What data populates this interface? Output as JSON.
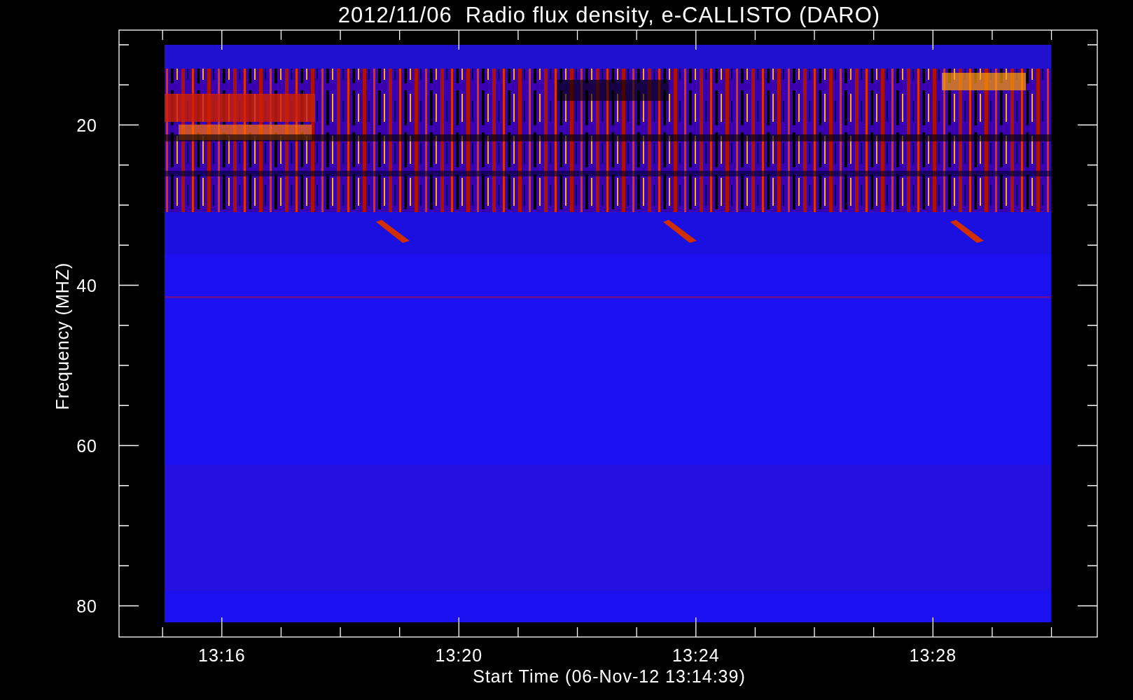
{
  "title": "2012/11/06  Radio flux density, e-CALLISTO (DARO)",
  "plot": {
    "ylabel": "Frequency (MHZ)",
    "xlabel": "Start Time (06-Nov-12 13:14:39)",
    "y_tick_labels": [
      "20",
      "40",
      "60",
      "80"
    ],
    "x_tick_labels": [
      "13:16",
      "13:20",
      "13:24",
      "13:28"
    ]
  }
}
